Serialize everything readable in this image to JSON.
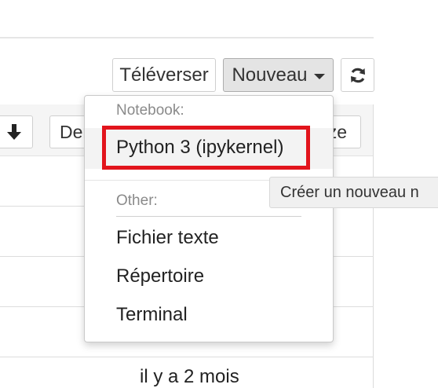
{
  "toolbar": {
    "upload_label": "Téléverser",
    "new_label": "Nouveau",
    "refresh_icon": "refresh-icon",
    "download_icon": "arrow-down-icon",
    "partial_left_label": "Der",
    "partial_right_label": "ze"
  },
  "menu": {
    "notebook_header": "Notebook:",
    "notebook_items": [
      {
        "label": "Python 3 (ipykernel)"
      }
    ],
    "other_header": "Other:",
    "other_items": [
      {
        "label": "Fichier texte"
      },
      {
        "label": "Répertoire"
      },
      {
        "label": "Terminal"
      }
    ]
  },
  "tooltip": {
    "text": "Créer un nouveau n"
  },
  "file_list": {
    "visible_last_modified": "il y a 2 mois"
  },
  "colors": {
    "highlight_box": "#e2141c",
    "new_button_bg": "#e4e4e4"
  }
}
